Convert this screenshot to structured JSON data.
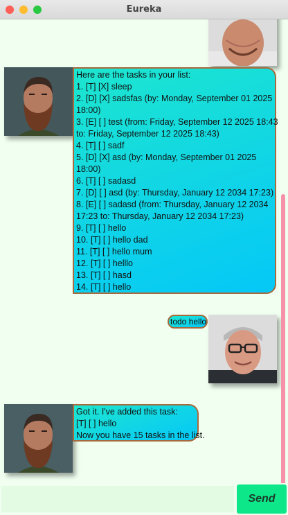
{
  "window": {
    "title": "Eureka"
  },
  "messages": [
    {
      "sender": "bot",
      "lines": [
        "Here are the tasks in your list:",
        "1. [T] [X] sleep",
        "2. [D] [X] sadsfas (by: Monday, September 01 2025",
        "18:00)",
        "3. [E] [ ] test (from: Friday, September 12 2025 18:43",
        "to: Friday, September 12 2025 18:43)",
        "4. [T] [ ] sadf",
        "5. [D] [X] asd (by: Monday, September 01 2025",
        "18:00)",
        "6. [T] [ ] sadasd",
        "7. [D] [ ] asd (by: Thursday, January 12 2034 17:23)",
        "8. [E] [ ] sadasd (from: Thursday, January 12 2034",
        "17:23 to: Thursday, January 12 2034 17:23)",
        "9. [T] [ ] hello",
        "10. [T] [ ] hello dad",
        "11. [T] [ ] hello mum",
        "12. [T] [ ] helllo",
        "13. [T] [ ] hasd",
        "14. [T] [ ] hello"
      ]
    },
    {
      "sender": "user",
      "lines": [
        "todo hello"
      ]
    },
    {
      "sender": "bot",
      "lines": [
        "Got it. I've added this task:",
        "[T] [ ] hello",
        "Now you have 15 tasks in the list."
      ]
    }
  ],
  "input": {
    "value": "",
    "placeholder": ""
  },
  "send_button": {
    "label": "Send"
  },
  "colors": {
    "background": "#f0fff0",
    "bubble_gradient_start": "#1de6cf",
    "bubble_gradient_end": "#05c8f7",
    "bubble_border": "#a66a3c",
    "send_button": "#0ee68a",
    "scrollbar": "#f592a9"
  }
}
